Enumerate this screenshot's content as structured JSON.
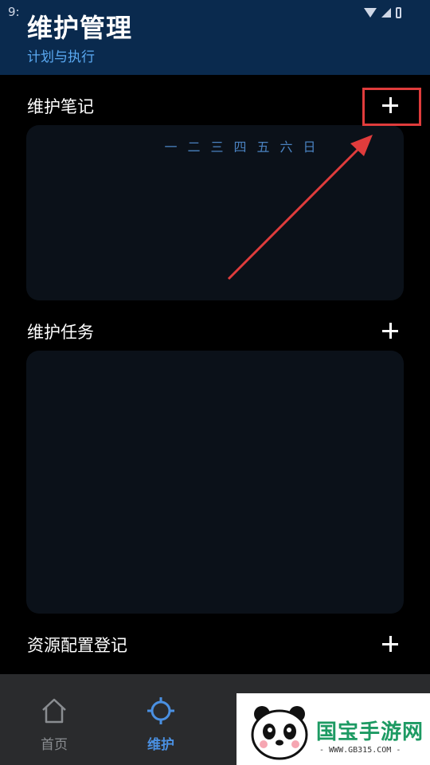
{
  "status_bar": {
    "time": "9:"
  },
  "header": {
    "title": "维护管理",
    "subtitle": "计划与执行"
  },
  "sections": {
    "notes": {
      "title": "维护笔记",
      "weekdays": [
        "一",
        "二",
        "三",
        "四",
        "五",
        "六",
        "日"
      ]
    },
    "tasks": {
      "title": "维护任务"
    },
    "resources": {
      "title": "资源配置登记"
    }
  },
  "bottom_nav": [
    {
      "label": "首页",
      "icon": "home-icon",
      "active": false,
      "color": "#8a8d91"
    },
    {
      "label": "维护",
      "icon": "crosshair-icon",
      "active": true,
      "color": "#4a90e2"
    }
  ],
  "watermark": {
    "brand": "国宝手游网",
    "url": "- WWW.GB315.COM -",
    "icon": "panda-logo"
  },
  "annotations": {
    "highlight_color": "#e03c3c",
    "arrow_color": "#e03c3c"
  }
}
